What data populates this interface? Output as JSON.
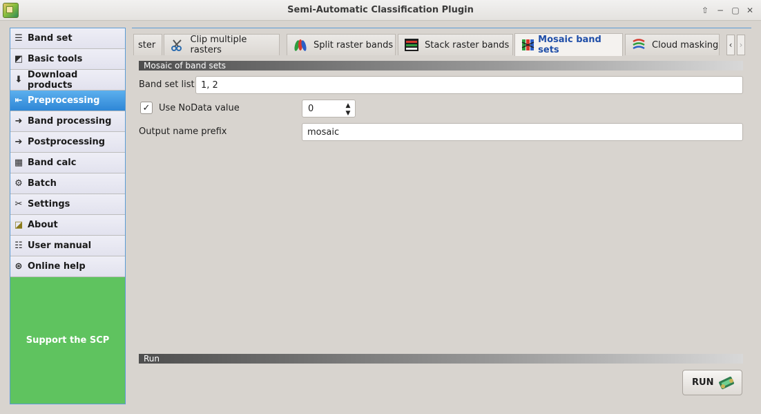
{
  "window": {
    "title": "Semi-Automatic Classification Plugin",
    "controls": [
      "restore-up",
      "minimize",
      "maximize",
      "close"
    ]
  },
  "sidebar": {
    "items": [
      {
        "label": "Band set",
        "icon": "band-set-icon"
      },
      {
        "label": "Basic tools",
        "icon": "basic-tools-icon"
      },
      {
        "label": "Download products",
        "icon": "download-icon"
      },
      {
        "label": "Preprocessing",
        "icon": "preprocessing-icon",
        "active": true
      },
      {
        "label": "Band processing",
        "icon": "band-processing-icon"
      },
      {
        "label": "Postprocessing",
        "icon": "postprocessing-icon"
      },
      {
        "label": "Band calc",
        "icon": "band-calc-icon"
      },
      {
        "label": "Batch",
        "icon": "batch-icon"
      },
      {
        "label": "Settings",
        "icon": "settings-icon"
      },
      {
        "label": "About",
        "icon": "about-icon"
      },
      {
        "label": "User manual",
        "icon": "user-manual-icon"
      },
      {
        "label": "Online help",
        "icon": "online-help-icon"
      }
    ],
    "support_label": "Support the SCP"
  },
  "tabs": [
    {
      "label": "ster",
      "icon": ""
    },
    {
      "label": "Clip multiple rasters",
      "icon": "scissors-icon"
    },
    {
      "label": "Split raster bands",
      "icon": "split-bands-icon"
    },
    {
      "label": "Stack raster bands",
      "icon": "stack-bands-icon"
    },
    {
      "label": "Mosaic band sets",
      "icon": "mosaic-icon",
      "active": true
    },
    {
      "label": "Cloud masking",
      "icon": "cloud-masking-icon"
    }
  ],
  "mosaic": {
    "section_title": "Mosaic of band sets",
    "band_set_list_label": "Band set list",
    "band_set_list_value": "1, 2",
    "use_nodata_label": "Use NoData value",
    "use_nodata_checked": true,
    "nodata_value": "0",
    "output_prefix_label": "Output name prefix",
    "output_prefix_value": "mosaic"
  },
  "run": {
    "section_title": "Run",
    "button_label": "RUN"
  },
  "colors": {
    "active_sidebar": "#2e86d6",
    "support_bg": "#5fc35f",
    "active_tab_text": "#1f4ea8"
  }
}
